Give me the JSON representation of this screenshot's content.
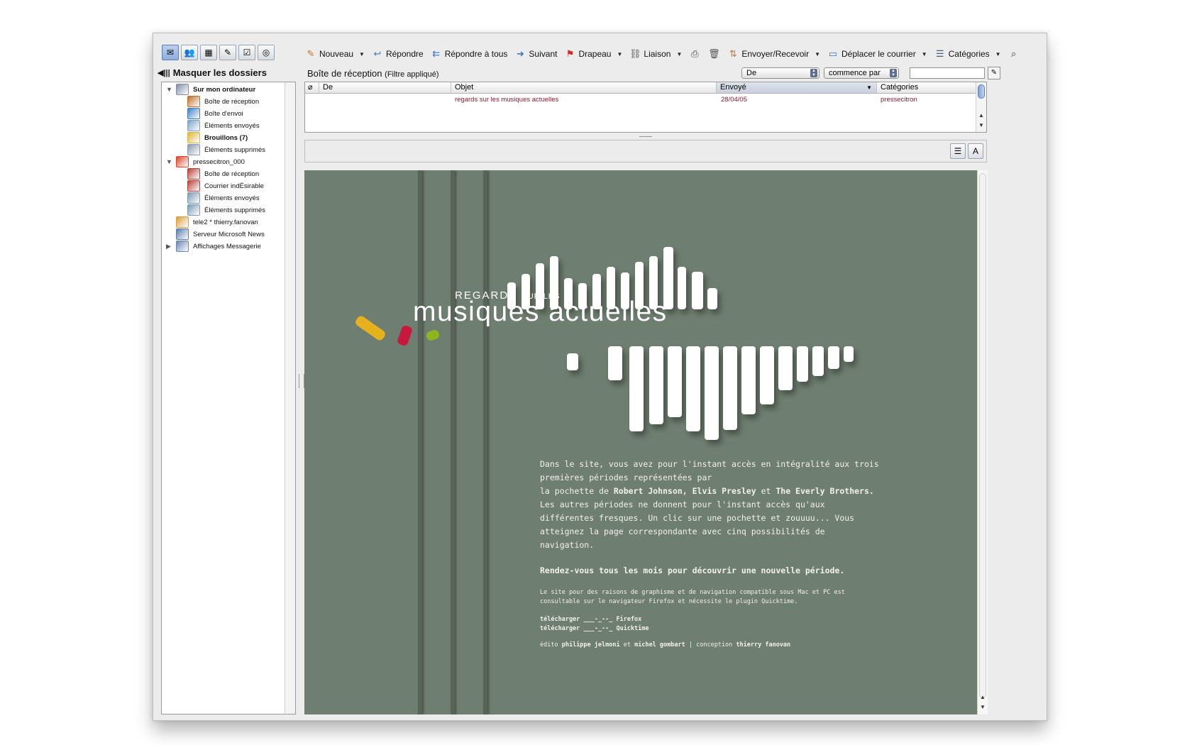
{
  "toolbar": {
    "items": [
      {
        "label": "Nouveau",
        "icon": "new-icon",
        "dropdown": true
      },
      {
        "label": "Répondre",
        "icon": "reply-icon",
        "dropdown": false
      },
      {
        "label": "Répondre à tous",
        "icon": "reply-all-icon",
        "dropdown": false
      },
      {
        "label": "Suivant",
        "icon": "forward-icon",
        "dropdown": false
      },
      {
        "label": "Drapeau",
        "icon": "flag-icon",
        "dropdown": true
      },
      {
        "label": "Liaison",
        "icon": "link-icon",
        "dropdown": true
      },
      {
        "label": "",
        "icon": "print-icon",
        "dropdown": false
      },
      {
        "label": "",
        "icon": "trash-icon",
        "dropdown": false
      },
      {
        "label": "Envoyer/Recevoir",
        "icon": "send-receive-icon",
        "dropdown": true
      },
      {
        "label": "Déplacer le courrier",
        "icon": "move-folder-icon",
        "dropdown": true
      },
      {
        "label": "Catégories",
        "icon": "categories-icon",
        "dropdown": true
      },
      {
        "label": "",
        "icon": "search-icon",
        "dropdown": false
      }
    ]
  },
  "sidebar": {
    "hide_label": "Masquer les dossiers",
    "folders": [
      {
        "label": "Sur mon ordinateur",
        "level": 0,
        "tri": "▼",
        "bold": true,
        "color": "#7d8fa8"
      },
      {
        "label": "Boîte de réception",
        "level": 1,
        "tri": "",
        "bold": false,
        "color": "#c0702c"
      },
      {
        "label": "Boîte d'envoi",
        "level": 1,
        "tri": "",
        "bold": false,
        "color": "#3f7fc4"
      },
      {
        "label": "Éléments envoyés",
        "level": 1,
        "tri": "",
        "bold": false,
        "color": "#7aa0c8"
      },
      {
        "label": "Brouillons (7)",
        "level": 1,
        "tri": "",
        "bold": true,
        "color": "#d9b640"
      },
      {
        "label": "Éléments supprimés",
        "level": 1,
        "tri": "",
        "bold": false,
        "color": "#8a9aae"
      },
      {
        "label": "pressecitron_000",
        "level": 0,
        "tri": "▼",
        "bold": false,
        "color": "#d8472c"
      },
      {
        "label": "Boîte de réception",
        "level": 1,
        "tri": "",
        "bold": false,
        "color": "#b5433b"
      },
      {
        "label": "Courrier indÉsirable",
        "level": 1,
        "tri": "",
        "bold": false,
        "color": "#b5433b"
      },
      {
        "label": "Éléments envoyés",
        "level": 1,
        "tri": "",
        "bold": false,
        "color": "#7a9ab3"
      },
      {
        "label": "Éléments supprimés",
        "level": 1,
        "tri": "",
        "bold": false,
        "color": "#7a9ab3"
      },
      {
        "label": "tele2 * thierry.fanovan",
        "level": 0,
        "tri": "",
        "bold": false,
        "color": "#d9a040"
      },
      {
        "label": "Serveur Microsoft News",
        "level": 0,
        "tri": "",
        "bold": false,
        "color": "#5a7ea8"
      },
      {
        "label": "Affichages Messagerie",
        "level": 0,
        "tri": "▶",
        "bold": false,
        "color": "#6a86b3"
      }
    ]
  },
  "list": {
    "title": "Boîte de réception",
    "filter_note": "(Filtre appliqué)",
    "filter_field": "De",
    "filter_mode": "commence par",
    "filter_value": "",
    "columns": [
      "De",
      "Objet",
      "Envoyé",
      "Catégories"
    ],
    "rows": [
      {
        "from": "",
        "subject": "regards sur les musiques actuelles",
        "sent": "28/04/05",
        "category": "pressecitron"
      }
    ]
  },
  "email": {
    "logo_small": "REGARDS",
    "logo_small_b": "SUR LES",
    "logo_big": "musiques actuelles",
    "p1": "Dans le site, vous avez pour l'instant accès en intégralité aux trois premières périodes représentées par",
    "p2a": "la pochette de ",
    "p2b": "Robert Johnson, Elvis Presley",
    "p2c": " et ",
    "p2d": "The Everly Brothers.",
    "p3": "Les autres périodes ne donnent pour l'instant accès qu'aux différentes fresques. Un clic sur une pochette et zouuuu... Vous atteignez la page correspondante avec cinq possibilités de navigation.",
    "p4": "Rendez-vous tous les mois pour découvrir une nouvelle période.",
    "p5": "Le site pour des raisons de graphisme et de navigation compatible sous Mac et PC est consultable sur le navigateur Firefox et nécessite le plugin Quicktime.",
    "dl1a": "télécharger ___-_--_ ",
    "dl1b": "Firefox",
    "dl2a": "télécharger ___-_--_ ",
    "dl2b": "Quicktime",
    "c1": "édito ",
    "c2": "philippe jelmoni",
    "c3": " et ",
    "c4": "michel gombart",
    "c5": " | conception ",
    "c6": "thierry fanovan",
    "accent_colors": [
      "#e5b21e",
      "#c8183e",
      "#8fb51f"
    ]
  }
}
